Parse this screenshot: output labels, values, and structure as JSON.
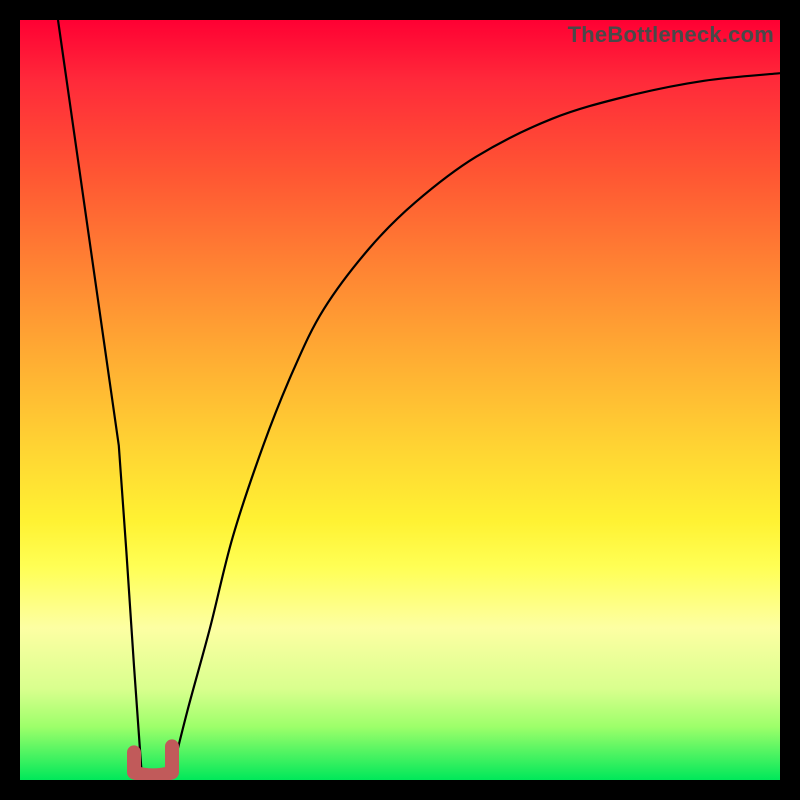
{
  "watermark": "TheBottleneck.com",
  "colors": {
    "top_gradient": "#ff0033",
    "mid_gradient": "#ffd333",
    "bottom_gradient": "#00e85a",
    "curve": "#000000",
    "minimum_marker": "#c15a5a",
    "frame": "#000000"
  },
  "chart_data": {
    "type": "line",
    "title": "",
    "xlabel": "",
    "ylabel": "",
    "xlim": [
      0,
      100
    ],
    "ylim": [
      0,
      100
    ],
    "series": [
      {
        "name": "left-branch",
        "x": [
          5,
          6,
          7,
          8,
          9,
          10,
          11,
          12,
          13,
          14,
          15,
          16
        ],
        "values": [
          100,
          93,
          86,
          79,
          72,
          65,
          58,
          51,
          44,
          30,
          15,
          1
        ]
      },
      {
        "name": "right-branch",
        "x": [
          20,
          22,
          25,
          28,
          32,
          36,
          40,
          46,
          52,
          60,
          70,
          80,
          90,
          100
        ],
        "values": [
          1,
          9,
          20,
          32,
          44,
          54,
          62,
          70,
          76,
          82,
          87,
          90,
          92,
          93
        ]
      }
    ],
    "minimum_marker": {
      "x_range": [
        15,
        20
      ],
      "y": 1
    }
  }
}
